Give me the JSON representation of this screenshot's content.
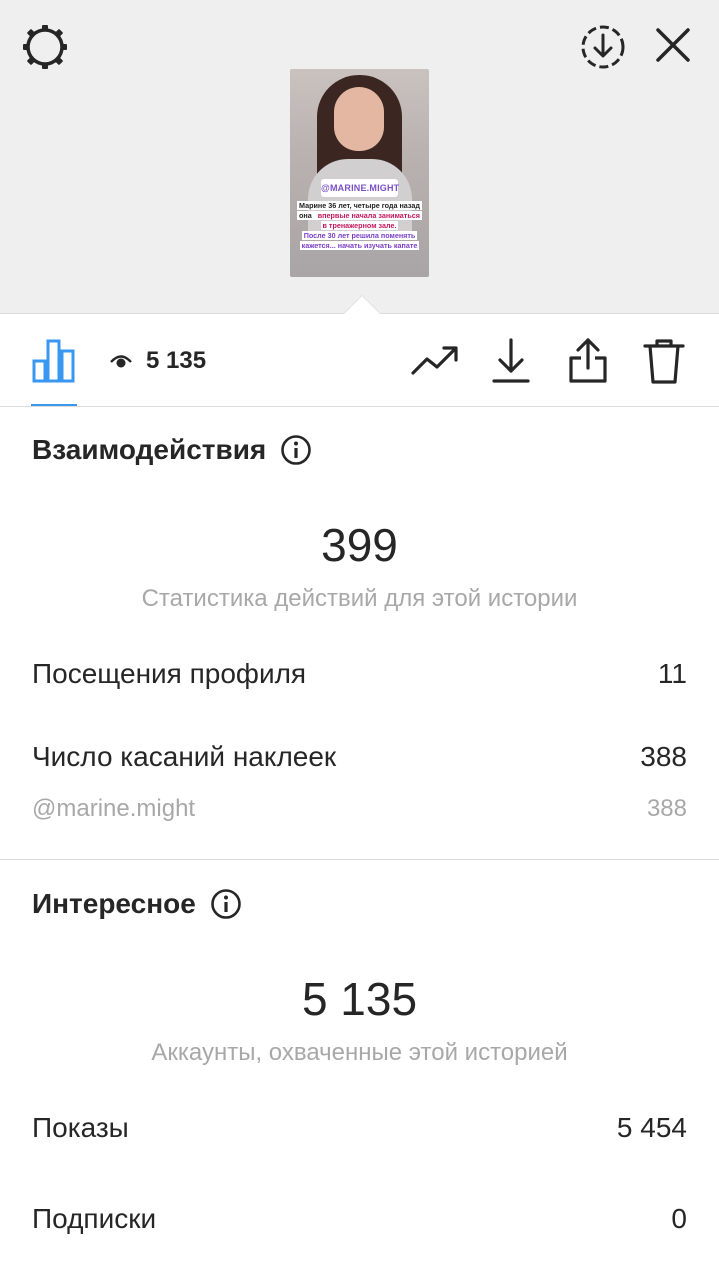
{
  "header": {
    "icons": {
      "settings": "gear-icon",
      "save": "download-circle-icon",
      "close": "close-icon"
    }
  },
  "story_preview": {
    "mention_sticker": "@MARINE.MIGHT",
    "caption_part1": "Марине 36 лет, четыре года назад она ",
    "caption_highlight1": "впервые начала заниматься в тренажерном зале.",
    "caption_part2": "После 30 лет решила поменять кажется... начать изучать капате"
  },
  "tabbar": {
    "views_count": "5 135",
    "icons": {
      "insights": "bar-chart-icon",
      "views": "eye-icon",
      "promote": "trending-up-icon",
      "download": "download-icon",
      "share": "share-icon",
      "delete": "trash-icon"
    }
  },
  "interactions": {
    "title": "Взаимодействия",
    "total": "399",
    "total_caption": "Статистика действий для этой истории",
    "rows": [
      {
        "label": "Посещения профиля",
        "value": "11"
      },
      {
        "label": "Число касаний наклеек",
        "value": "388"
      }
    ],
    "sub_row": {
      "label": "@marine.might",
      "value": "388"
    }
  },
  "discovery": {
    "title": "Интересное",
    "total": "5 135",
    "total_caption": "Аккаунты, охваченные этой историей",
    "rows": [
      {
        "label": "Показы",
        "value": "5 454"
      },
      {
        "label": "Подписки",
        "value": "0"
      }
    ]
  },
  "colors": {
    "accent": "#3897f0",
    "text": "#262626",
    "muted": "#a8a8a8",
    "divider": "#dbdbdb",
    "top_bg": "#efefef"
  }
}
